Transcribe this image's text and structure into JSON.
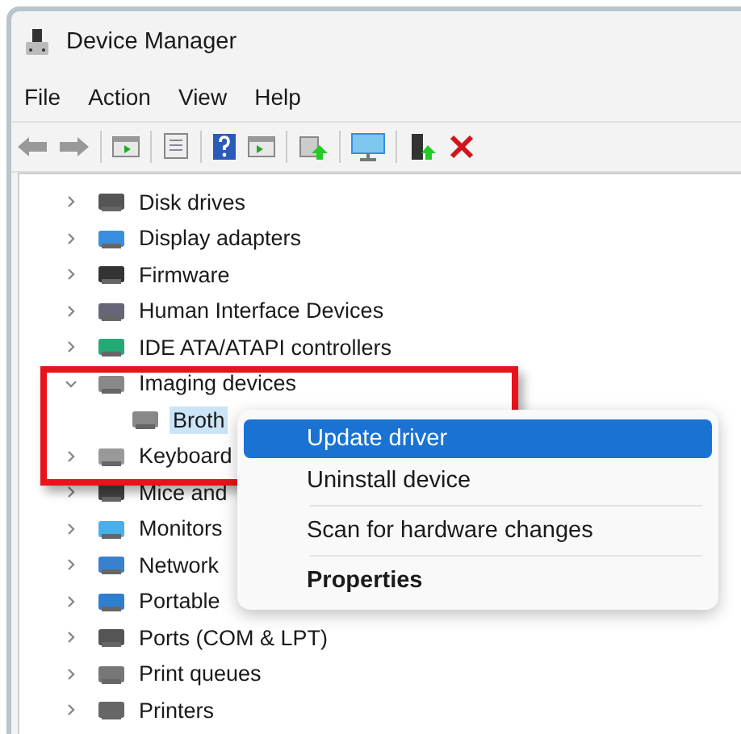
{
  "window": {
    "title": "Device Manager"
  },
  "menu_bar": [
    "File",
    "Action",
    "View",
    "Help"
  ],
  "tree": [
    {
      "label": "Disk drives",
      "expanded": false,
      "selected": false
    },
    {
      "label": "Display adapters",
      "expanded": false,
      "selected": false
    },
    {
      "label": "Firmware",
      "expanded": false,
      "selected": false
    },
    {
      "label": "Human Interface Devices",
      "expanded": false,
      "selected": false
    },
    {
      "label": "IDE ATA/ATAPI controllers",
      "expanded": false,
      "selected": false
    },
    {
      "label": "Imaging devices",
      "expanded": true,
      "selected": false,
      "children": [
        {
          "label": "Broth",
          "selected": true
        }
      ]
    },
    {
      "label": "Keyboard",
      "expanded": false,
      "selected": false
    },
    {
      "label": "Mice and",
      "expanded": false,
      "selected": false
    },
    {
      "label": "Monitors",
      "expanded": false,
      "selected": false
    },
    {
      "label": "Network",
      "expanded": false,
      "selected": false
    },
    {
      "label": "Portable",
      "expanded": false,
      "selected": false
    },
    {
      "label": "Ports (COM & LPT)",
      "expanded": false,
      "selected": false
    },
    {
      "label": "Print queues",
      "expanded": false,
      "selected": false
    },
    {
      "label": "Printers",
      "expanded": false,
      "selected": false
    }
  ],
  "context_menu": [
    {
      "kind": "item",
      "label": "Update driver",
      "selected": true,
      "default": false
    },
    {
      "kind": "item",
      "label": "Uninstall device",
      "selected": false,
      "default": false
    },
    {
      "kind": "separator"
    },
    {
      "kind": "item",
      "label": "Scan for hardware changes",
      "selected": false,
      "default": false
    },
    {
      "kind": "separator"
    },
    {
      "kind": "item",
      "label": "Properties",
      "selected": false,
      "default": true
    }
  ]
}
